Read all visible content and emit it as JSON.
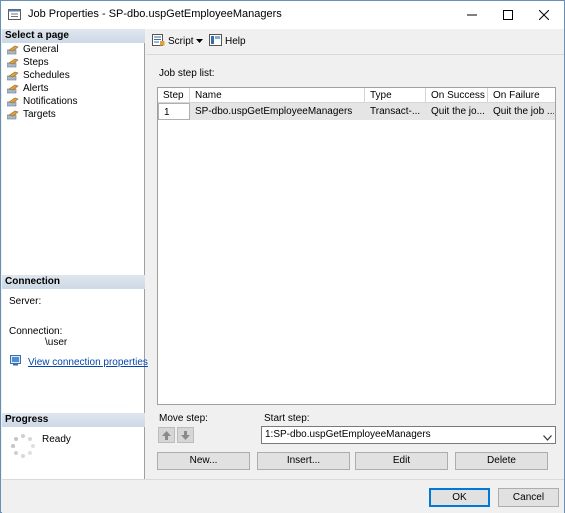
{
  "window": {
    "title": "Job Properties - SP-dbo.uspGetEmployeeManagers"
  },
  "left_pane": {
    "select_page_header": "Select a page",
    "pages": [
      {
        "label": "General",
        "icon": "wrench-icon"
      },
      {
        "label": "Steps",
        "icon": "wrench-icon"
      },
      {
        "label": "Schedules",
        "icon": "wrench-icon"
      },
      {
        "label": "Alerts",
        "icon": "wrench-icon"
      },
      {
        "label": "Notifications",
        "icon": "wrench-icon"
      },
      {
        "label": "Targets",
        "icon": "wrench-icon"
      }
    ],
    "connection_header": "Connection",
    "server_label": "Server:",
    "connection_label": "Connection:",
    "connection_user": "\\user",
    "view_connection_link": "View connection properties",
    "progress_header": "Progress",
    "progress_status": "Ready"
  },
  "toolbar": {
    "script_label": "Script",
    "help_label": "Help"
  },
  "main": {
    "job_step_list_label": "Job step list:",
    "columns": [
      "Step",
      "Name",
      "Type",
      "On Success",
      "On Failure"
    ],
    "rows": [
      {
        "step": "1",
        "name": "SP-dbo.uspGetEmployeeManagers",
        "type": "Transact-...",
        "on_success": "Quit the jo...",
        "on_failure": "Quit the job ..."
      }
    ],
    "move_step_label": "Move step:",
    "start_step_label": "Start step:",
    "start_step_value": "1:SP-dbo.uspGetEmployeeManagers",
    "buttons": {
      "new": "New...",
      "insert": "Insert...",
      "edit": "Edit",
      "delete": "Delete"
    }
  },
  "footer": {
    "ok": "OK",
    "cancel": "Cancel"
  },
  "colors": {
    "accent": "#0078d7",
    "link": "#0645ad",
    "header_gradient": "#cdd9e6"
  }
}
